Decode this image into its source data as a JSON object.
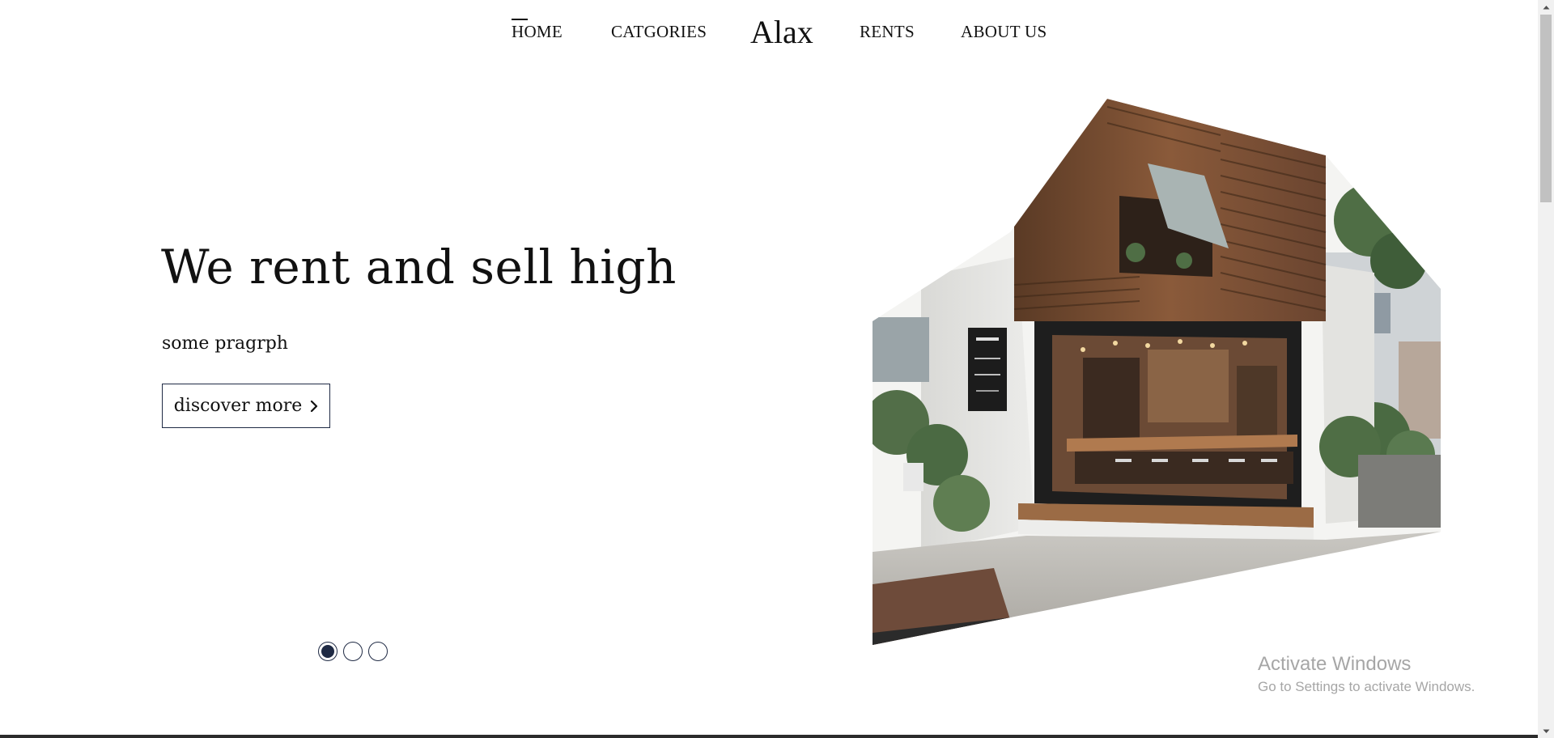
{
  "nav": {
    "home": "HOME",
    "categories": "CATGORIES",
    "brand": "Alax",
    "rents": "RENTS",
    "about": "ABOUT US",
    "active_item": "HOME"
  },
  "hero": {
    "title": "We rent and sell high",
    "paragraph": "some pragrph",
    "cta_label": "discover more",
    "cta_icon": "chevron-right-icon"
  },
  "slider": {
    "total": 3,
    "active_index": 1
  },
  "watermark": {
    "title": "Activate Windows",
    "subtitle": "Go to Settings to activate Windows."
  },
  "colors": {
    "text": "#111111",
    "accent": "#1f2a44",
    "watermark": "#a6a6a6",
    "background": "#ffffff"
  }
}
